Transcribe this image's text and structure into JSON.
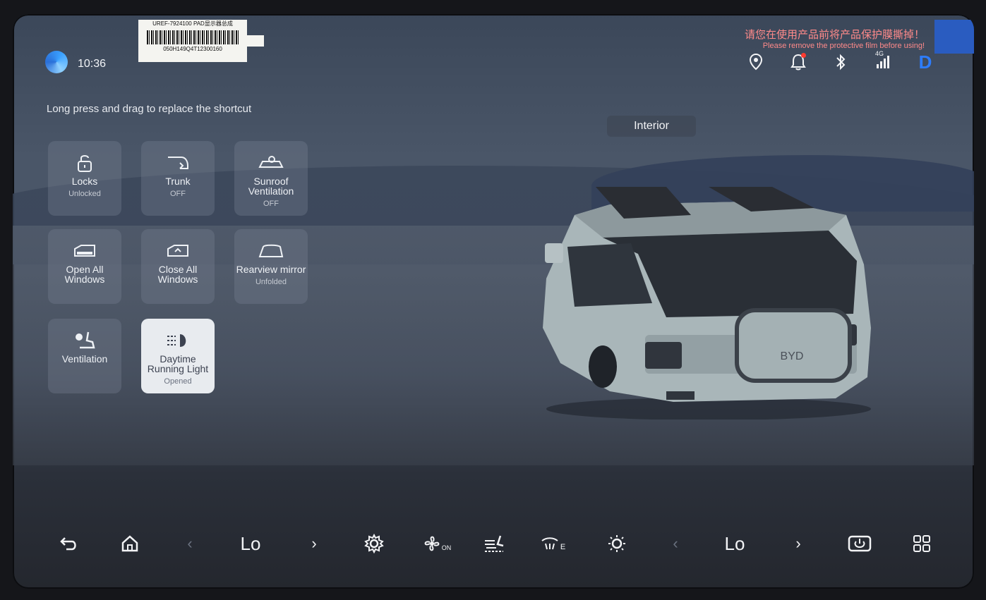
{
  "status_bar": {
    "time": "10:36",
    "gear": "D",
    "network": "4G"
  },
  "sticker": {
    "top": "UREF-7924100 PAD显示器总成",
    "code": "050H149Q4T12300160"
  },
  "film_warning": {
    "cn": "请您在使用产品前将产品保护膜撕掉！",
    "en": "Please remove the protective film before using!"
  },
  "hint": "Long press and drag to replace the shortcut",
  "view_button": "Interior",
  "shortcuts": [
    {
      "name": "Locks",
      "state": "Unlocked",
      "icon": "lock-icon",
      "active": false
    },
    {
      "name": "Trunk",
      "state": "OFF",
      "icon": "trunk-icon",
      "active": false
    },
    {
      "name": "Sunroof Ventilation",
      "state": "OFF",
      "icon": "sunroof-icon",
      "active": false
    },
    {
      "name": "Open All Windows",
      "state": "",
      "icon": "window-open-icon",
      "active": false
    },
    {
      "name": "Close All Windows",
      "state": "",
      "icon": "window-close-icon",
      "active": false
    },
    {
      "name": "Rearview mirror",
      "state": "Unfolded",
      "icon": "mirror-icon",
      "active": false
    },
    {
      "name": "Ventilation",
      "state": "",
      "icon": "seat-ventilation-icon",
      "active": false
    },
    {
      "name": "Daytime Running Light",
      "state": "Opened",
      "icon": "daytime-light-icon",
      "active": true
    }
  ],
  "dock": {
    "left_temp": "Lo",
    "right_temp": "Lo",
    "fan_label": "ON",
    "defrost_label": "E"
  },
  "colors": {
    "accent": "#3d8dff",
    "gear": "#2d7dff",
    "active_tile": "#e8ebef"
  }
}
